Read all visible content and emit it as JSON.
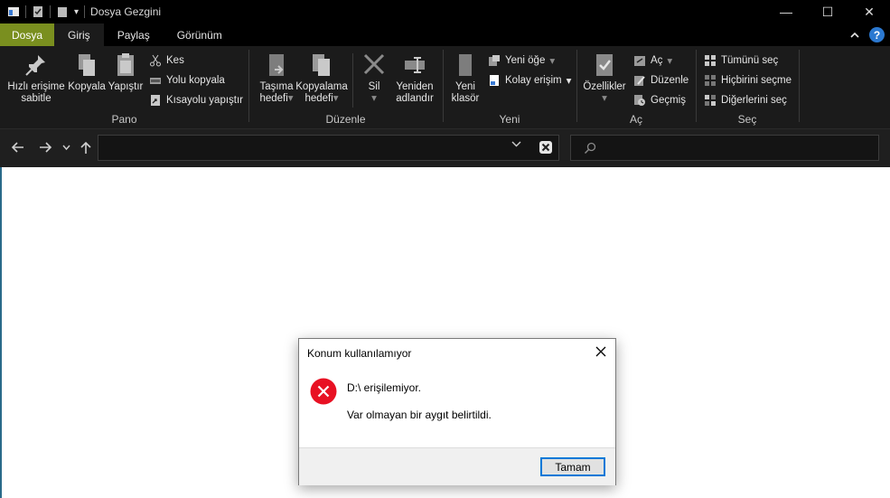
{
  "window": {
    "title": "Dosya Gezgini",
    "controls": {
      "minimize": "—",
      "maximize": "☐",
      "close": "✕"
    }
  },
  "tabs": [
    {
      "label": "Dosya"
    },
    {
      "label": "Giriş"
    },
    {
      "label": "Paylaş"
    },
    {
      "label": "Görünüm"
    }
  ],
  "ribbon": {
    "pano": {
      "label": "Pano",
      "pin_line1": "Hızlı erişime",
      "pin_line2": "sabitle",
      "copy": "Kopyala",
      "paste": "Yapıştır",
      "cut": "Kes",
      "copy_path": "Yolu kopyala",
      "paste_shortcut": "Kısayolu yapıştır"
    },
    "duzenle": {
      "label": "Düzenle",
      "move_line1": "Taşıma",
      "move_line2": "hedefi",
      "copy_line1": "Kopyalama",
      "copy_line2": "hedefi",
      "delete": "Sil",
      "rename_line1": "Yeniden",
      "rename_line2": "adlandır"
    },
    "yeni": {
      "label": "Yeni",
      "folder_line1": "Yeni",
      "folder_line2": "klasör",
      "new_item": "Yeni öğe",
      "easy_access": "Kolay erişim"
    },
    "ac": {
      "label": "Aç",
      "properties": "Özellikler",
      "open": "Aç",
      "edit": "Düzenle",
      "history": "Geçmiş"
    },
    "sec": {
      "label": "Seç",
      "select_all": "Tümünü seç",
      "select_none": "Hiçbirini seçme",
      "invert": "Diğerlerini seç"
    }
  },
  "nav": {
    "address_value": "",
    "search_placeholder": ""
  },
  "dialog": {
    "title": "Konum kullanılamıyor",
    "message": "D:\\ erişilemiyor.",
    "detail": "Var olmayan bir aygıt belirtildi.",
    "ok_label": "Tamam",
    "icon": "error-icon"
  },
  "colors": {
    "file_tab": "#7a8f1f",
    "ribbon_bg": "#1b1b1b",
    "error_red": "#e81123",
    "focus_blue": "#0078d7"
  }
}
